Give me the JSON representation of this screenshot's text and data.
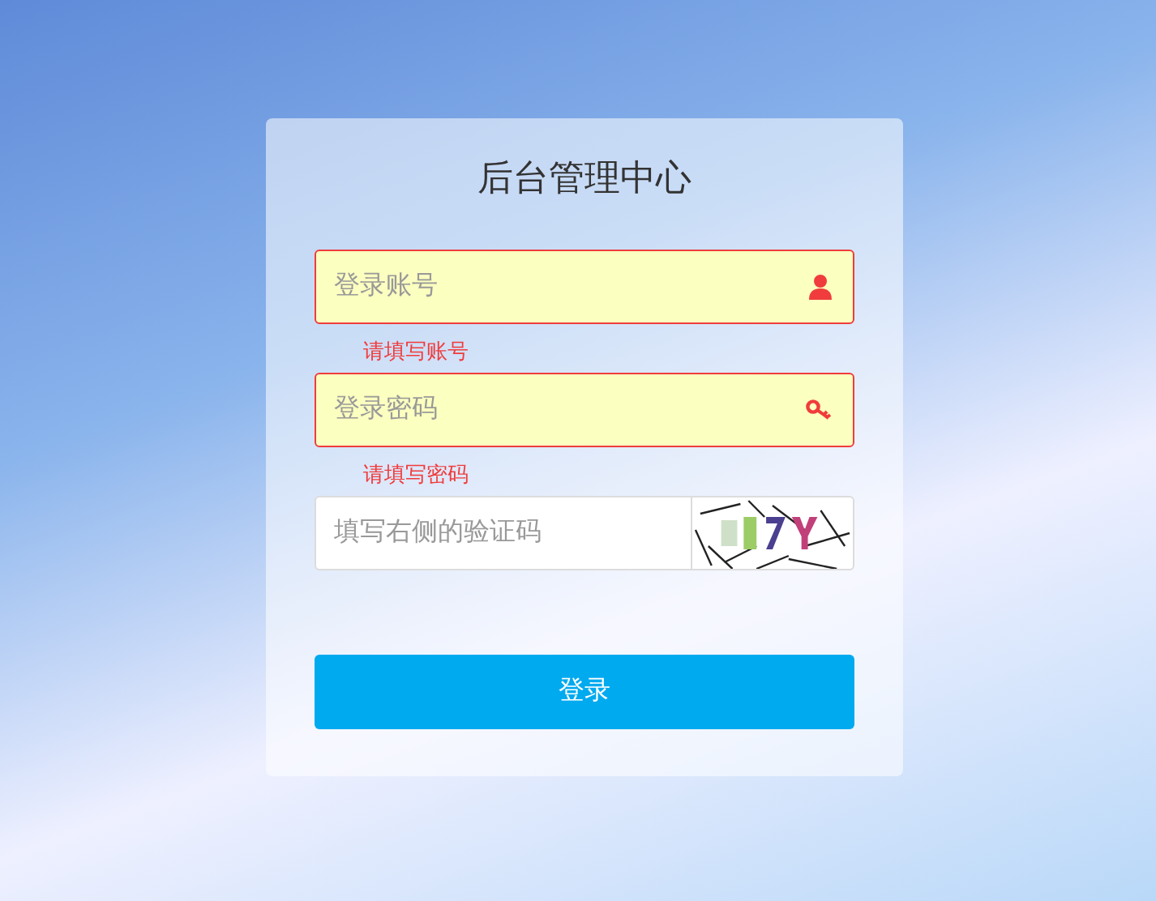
{
  "title": "后台管理中心",
  "fields": [
    {
      "kind": "user",
      "placeholder": "登录账号",
      "invalid": true,
      "error": "请填写账号"
    },
    {
      "kind": "password",
      "placeholder": "登录密码",
      "invalid": true,
      "error": "请填写密码"
    },
    {
      "kind": "captcha",
      "placeholder": "填写右侧的验证码",
      "invalid": false
    }
  ],
  "button": "登录"
}
